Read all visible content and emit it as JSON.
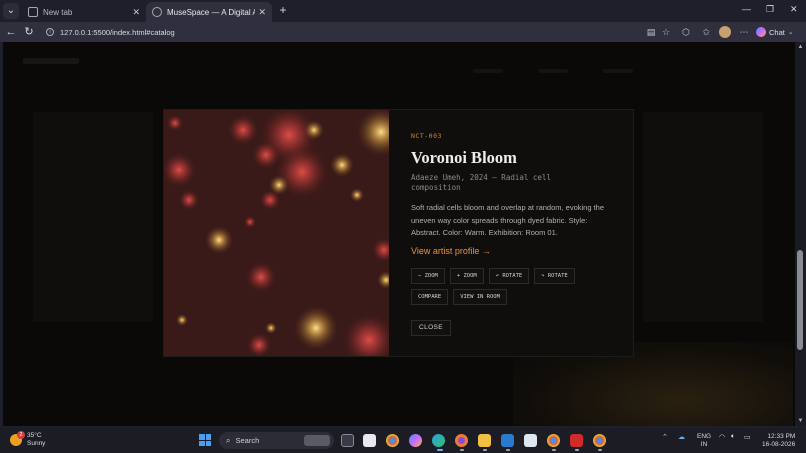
{
  "browser": {
    "tabs": [
      {
        "label": "New tab",
        "active": false
      },
      {
        "label": "MuseSpace — A Digital Art Gallery",
        "active": true
      }
    ],
    "url": "127.0.0.1:5500/index.html#catalog",
    "chat_label": "Chat",
    "window_controls": {
      "minimize": "—",
      "restore": "❐",
      "close": "✕"
    }
  },
  "modal": {
    "code": "NCT-003",
    "title": "Voronoi Bloom",
    "byline": "Adaeze Umeh, 2024 — Radial cell composition",
    "description": "Soft radial cells bloom and overlap at random, evoking the uneven way color spreads through dyed fabric. Style: Abstract. Color: Warm. Exhibition: Room 01.",
    "artist_link": "View artist profile →",
    "controls": [
      "− ZOOM",
      "+ ZOOM",
      "↶ ROTATE",
      "↷ ROTATE",
      "COMPARE",
      "VIEW IN ROOM"
    ],
    "close_label": "CLOSE",
    "colors": {
      "accent": "#d9872b",
      "bg": "#0f0e0d",
      "artwork_bg": "#3a1a18"
    }
  },
  "taskbar": {
    "weather_temp": "35°C",
    "weather_desc": "Sunny",
    "weather_badge": "2",
    "search_label": "Search",
    "lang_line1": "ENG",
    "lang_line2": "IN",
    "time": "12:33 PM",
    "date": "16-08-2026"
  }
}
